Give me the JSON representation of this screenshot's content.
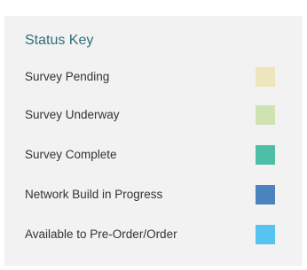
{
  "status_key": {
    "title": "Status Key",
    "items": [
      {
        "label": "Survey Pending",
        "color": "#ede5bb"
      },
      {
        "label": "Survey Underway",
        "color": "#cfe2b2"
      },
      {
        "label": "Survey Complete",
        "color": "#4cbfa6"
      },
      {
        "label": "Network Build in Progress",
        "color": "#4a83bd"
      },
      {
        "label": "Available to Pre-Order/Order",
        "color": "#56c3f1"
      }
    ]
  }
}
